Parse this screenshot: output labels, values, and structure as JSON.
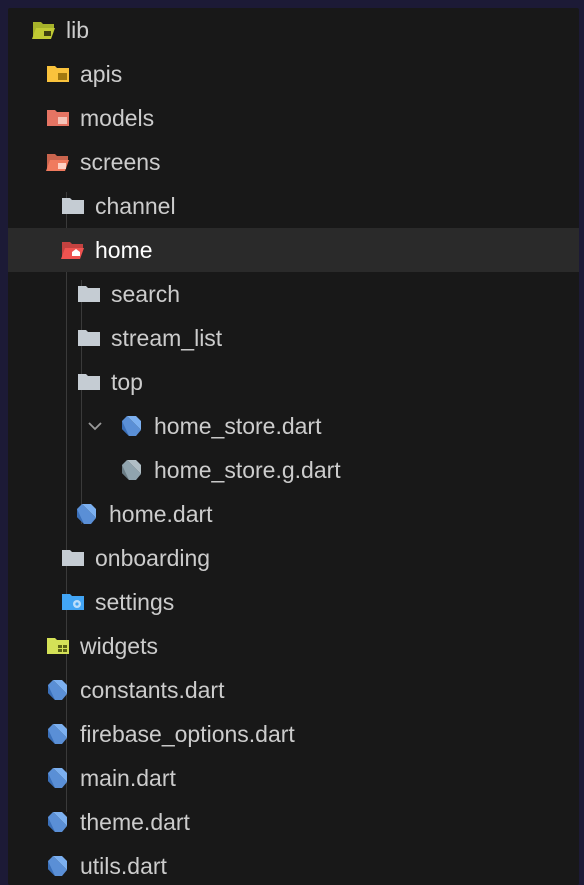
{
  "colors": {
    "page_background": "#1c1a36",
    "panel_background": "#181818",
    "selected_row": "#2a2a2a",
    "text": "#cccccc",
    "folder_gray": "#c5ccd3",
    "folder_lib": "#c0ca33",
    "folder_apis": "#f9c23c",
    "folder_models": "#e57463",
    "folder_screens": "#f07a5e",
    "folder_home": "#ef5350",
    "folder_settings": "#42a5f5",
    "folder_widgets": "#d4e157",
    "dart_blue": "#5a8fd6",
    "dart_gray": "#90a4ae"
  },
  "tree": {
    "items": [
      {
        "label": "lib",
        "icon": "folder-lib-open-icon"
      },
      {
        "label": "apis",
        "icon": "folder-apis-icon"
      },
      {
        "label": "models",
        "icon": "folder-models-icon"
      },
      {
        "label": "screens",
        "icon": "folder-screens-open-icon"
      },
      {
        "label": "channel",
        "icon": "folder-icon"
      },
      {
        "label": "home",
        "icon": "folder-home-open-icon",
        "selected": true
      },
      {
        "label": "search",
        "icon": "folder-icon"
      },
      {
        "label": "stream_list",
        "icon": "folder-icon"
      },
      {
        "label": "top",
        "icon": "folder-icon"
      },
      {
        "label": "home_store.dart",
        "icon": "dart-file-icon",
        "expanded": true
      },
      {
        "label": "home_store.g.dart",
        "icon": "dart-generated-file-icon"
      },
      {
        "label": "home.dart",
        "icon": "dart-file-icon"
      },
      {
        "label": "onboarding",
        "icon": "folder-icon"
      },
      {
        "label": "settings",
        "icon": "folder-settings-icon"
      },
      {
        "label": "widgets",
        "icon": "folder-widgets-icon"
      },
      {
        "label": "constants.dart",
        "icon": "dart-file-icon"
      },
      {
        "label": "firebase_options.dart",
        "icon": "dart-file-icon"
      },
      {
        "label": "main.dart",
        "icon": "dart-file-icon"
      },
      {
        "label": "theme.dart",
        "icon": "dart-file-icon"
      },
      {
        "label": "utils.dart",
        "icon": "dart-file-icon"
      }
    ]
  }
}
